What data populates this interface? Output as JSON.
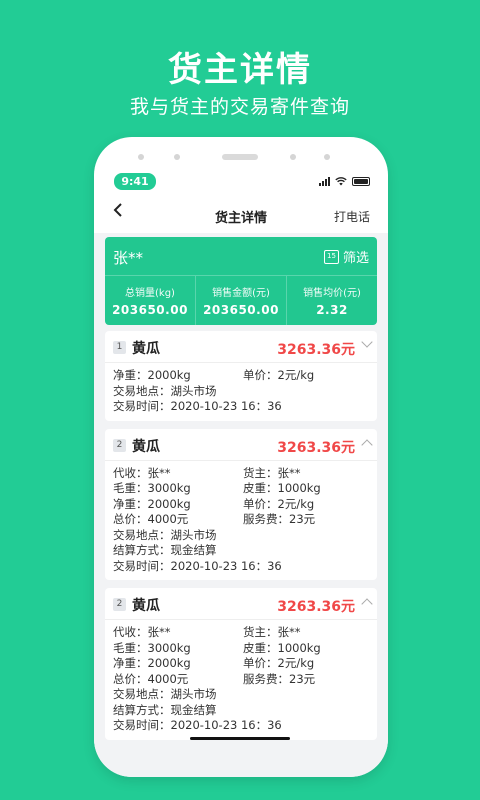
{
  "promo": {
    "title": "货主详情",
    "subtitle": "我与货主的交易寄件查询"
  },
  "status_bar": {
    "time": "9:41"
  },
  "nav": {
    "back_icon": "chevron-left-icon",
    "title": "货主详情",
    "call_label": "打电话"
  },
  "summary": {
    "owner_name": "张**",
    "filter_label": "筛选",
    "calendar_icon_text": "15",
    "stats": [
      {
        "label": "总销量(kg)",
        "value": "203650.00"
      },
      {
        "label": "销售金额(元)",
        "value": "203650.00"
      },
      {
        "label": "销售均价(元)",
        "value": "2.32"
      }
    ]
  },
  "colors": {
    "accent": "#22cc95",
    "amount": "#f04848"
  },
  "transactions": [
    {
      "index": "1",
      "product": "黄瓜",
      "amount": "3263.36元",
      "expanded": false,
      "net_weight": "净重：2000kg",
      "unit_price": "单价：2元/kg",
      "location": "交易地点：湖头市场",
      "time": "交易时间：2020-10-23 16：36"
    },
    {
      "index": "2",
      "product": "黄瓜",
      "amount": "3263.36元",
      "expanded": true,
      "agent": "代收：张**",
      "owner": "货主：张**",
      "gross_weight": "毛重：3000kg",
      "tare_weight": "皮重：1000kg",
      "net_weight": "净重：2000kg",
      "unit_price": "单价：2元/kg",
      "total_price": "总价：4000元",
      "service_fee": "服务费：23元",
      "location": "交易地点：湖头市场",
      "payment": "结算方式：现金结算",
      "time": "交易时间：2020-10-23 16：36"
    },
    {
      "index": "2",
      "product": "黄瓜",
      "amount": "3263.36元",
      "expanded": true,
      "agent": "代收：张**",
      "owner": "货主：张**",
      "gross_weight": "毛重：3000kg",
      "tare_weight": "皮重：1000kg",
      "net_weight": "净重：2000kg",
      "unit_price": "单价：2元/kg",
      "total_price": "总价：4000元",
      "service_fee": "服务费：23元",
      "location": "交易地点：湖头市场",
      "payment": "结算方式：现金结算",
      "time": "交易时间：2020-10-23 16：36"
    }
  ]
}
